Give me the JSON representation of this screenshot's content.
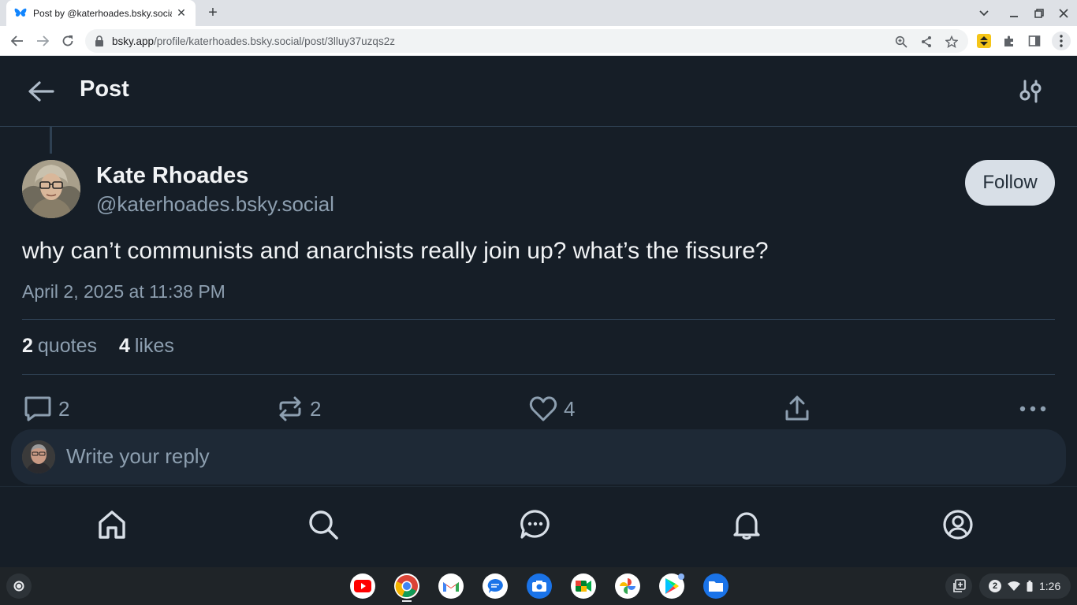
{
  "browser": {
    "tab_title": "Post by @katerhoades.bsky.social",
    "url_domain": "bsky.app",
    "url_path": "/profile/katerhoades.bsky.social/post/3lluy37uzqs2z"
  },
  "header": {
    "title": "Post"
  },
  "post": {
    "author_name": "Kate Rhoades",
    "author_handle": "@katerhoades.bsky.social",
    "follow_label": "Follow",
    "text": "why can’t communists and anarchists really join up? what’s the fissure?",
    "date": "April 2, 2025 at 11:38 PM",
    "stats": {
      "quotes_count": "2",
      "quotes_label": "quotes",
      "likes_count": "4",
      "likes_label": "likes"
    },
    "actions": {
      "reply_count": "2",
      "repost_count": "2",
      "like_count": "4"
    }
  },
  "reply_box": {
    "placeholder": "Write your reply"
  },
  "shelf": {
    "time": "1:26",
    "notifications": "2"
  },
  "colors": {
    "background": "#161e27",
    "text_primary": "#f1f3f5",
    "text_secondary": "#8d9fb0",
    "border": "#2e4052",
    "follow_bg": "#d8dfe7"
  }
}
